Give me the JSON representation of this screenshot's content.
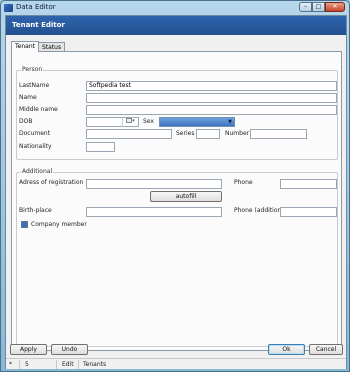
{
  "window": {
    "title": "Data Editor",
    "minimize": "–",
    "maximize": "□",
    "close": "✕"
  },
  "header": {
    "title": "Tenant Editor"
  },
  "tabs": [
    {
      "label": "Tenant"
    },
    {
      "label": "Status"
    }
  ],
  "person": {
    "group_title": "Person",
    "lastname_label": "LastName",
    "lastname_value": "Softpedia test",
    "name_label": "Name",
    "name_value": "",
    "middlename_label": "Middle name",
    "middlename_value": "",
    "dob_label": "DOB",
    "dob_value": "",
    "sex_label": "Sex",
    "sex_value": "",
    "document_label": "Document",
    "document_value": "",
    "series_label": "Series",
    "series_value": "",
    "number_label": "Number",
    "number_value": "",
    "nationality_label": "Nationality",
    "nationality_value": ""
  },
  "additional": {
    "group_title": "Additional",
    "address_label": "Adress of registration",
    "address_value": "",
    "autofill_label": "autofill",
    "phone_label": "Phone",
    "phone_value": "",
    "birthplace_label": "Birth-place",
    "birthplace_value": "",
    "phone_additional_label": "Phone (additional)",
    "phone_additional_value": "",
    "company_member_label": "Company member",
    "company_member_checked": true
  },
  "buttons": {
    "apply": "Apply",
    "undo": "Undo",
    "ok": "Ok",
    "cancel": "Cancel"
  },
  "statusbar": {
    "marker": "*",
    "count": "5",
    "mode": "Edit",
    "table": "Tenants"
  },
  "colors": {
    "header_bg": "#2f64ad",
    "accent": "#3a6db3"
  }
}
